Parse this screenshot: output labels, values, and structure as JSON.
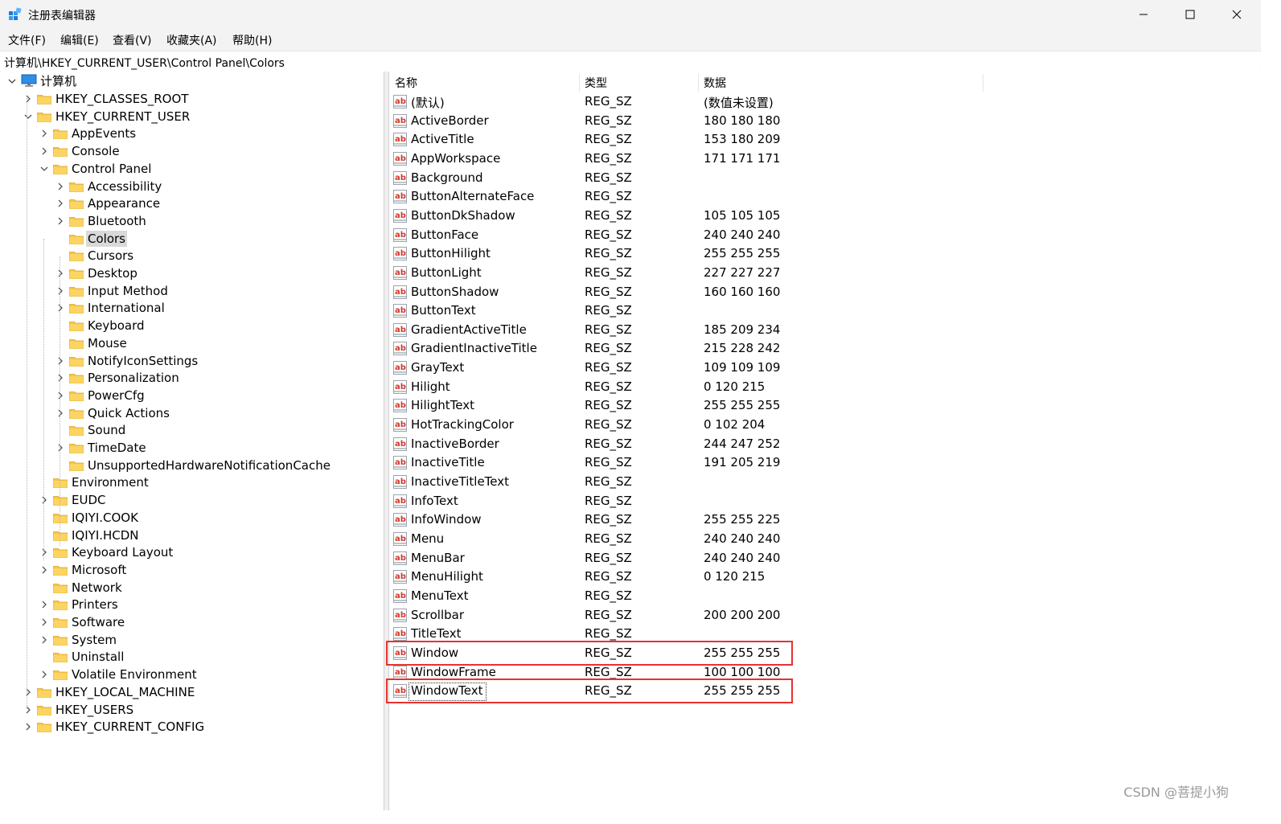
{
  "window": {
    "title": "注册表编辑器",
    "minimize_symbol": "—",
    "maximize_symbol": "☐",
    "close_symbol": "✕"
  },
  "menu": [
    "文件(F)",
    "编辑(E)",
    "查看(V)",
    "收藏夹(A)",
    "帮助(H)"
  ],
  "address": "计算机\\HKEY_CURRENT_USER\\Control Panel\\Colors",
  "tree": {
    "root": "计算机",
    "items": [
      {
        "label": "HKEY_CLASSES_ROOT",
        "level": 1,
        "expander": "collapsed"
      },
      {
        "label": "HKEY_CURRENT_USER",
        "level": 1,
        "expander": "expanded"
      },
      {
        "label": "AppEvents",
        "level": 2,
        "expander": "collapsed"
      },
      {
        "label": "Console",
        "level": 2,
        "expander": "collapsed"
      },
      {
        "label": "Control Panel",
        "level": 2,
        "expander": "expanded"
      },
      {
        "label": "Accessibility",
        "level": 3,
        "expander": "collapsed"
      },
      {
        "label": "Appearance",
        "level": 3,
        "expander": "collapsed"
      },
      {
        "label": "Bluetooth",
        "level": 3,
        "expander": "collapsed"
      },
      {
        "label": "Colors",
        "level": 3,
        "expander": "none",
        "selected": true
      },
      {
        "label": "Cursors",
        "level": 3,
        "expander": "none"
      },
      {
        "label": "Desktop",
        "level": 3,
        "expander": "collapsed"
      },
      {
        "label": "Input Method",
        "level": 3,
        "expander": "collapsed"
      },
      {
        "label": "International",
        "level": 3,
        "expander": "collapsed"
      },
      {
        "label": "Keyboard",
        "level": 3,
        "expander": "none"
      },
      {
        "label": "Mouse",
        "level": 3,
        "expander": "none"
      },
      {
        "label": "NotifyIconSettings",
        "level": 3,
        "expander": "collapsed"
      },
      {
        "label": "Personalization",
        "level": 3,
        "expander": "collapsed"
      },
      {
        "label": "PowerCfg",
        "level": 3,
        "expander": "collapsed"
      },
      {
        "label": "Quick Actions",
        "level": 3,
        "expander": "collapsed"
      },
      {
        "label": "Sound",
        "level": 3,
        "expander": "none"
      },
      {
        "label": "TimeDate",
        "level": 3,
        "expander": "collapsed"
      },
      {
        "label": "UnsupportedHardwareNotificationCache",
        "level": 3,
        "expander": "none"
      },
      {
        "label": "Environment",
        "level": 2,
        "expander": "none"
      },
      {
        "label": "EUDC",
        "level": 2,
        "expander": "collapsed"
      },
      {
        "label": "IQIYI.COOK",
        "level": 2,
        "expander": "none"
      },
      {
        "label": "IQIYI.HCDN",
        "level": 2,
        "expander": "none"
      },
      {
        "label": "Keyboard Layout",
        "level": 2,
        "expander": "collapsed"
      },
      {
        "label": "Microsoft",
        "level": 2,
        "expander": "collapsed"
      },
      {
        "label": "Network",
        "level": 2,
        "expander": "none"
      },
      {
        "label": "Printers",
        "level": 2,
        "expander": "collapsed"
      },
      {
        "label": "Software",
        "level": 2,
        "expander": "collapsed"
      },
      {
        "label": "System",
        "level": 2,
        "expander": "collapsed"
      },
      {
        "label": "Uninstall",
        "level": 2,
        "expander": "none"
      },
      {
        "label": "Volatile Environment",
        "level": 2,
        "expander": "collapsed"
      },
      {
        "label": "HKEY_LOCAL_MACHINE",
        "level": 1,
        "expander": "collapsed"
      },
      {
        "label": "HKEY_USERS",
        "level": 1,
        "expander": "collapsed"
      },
      {
        "label": "HKEY_CURRENT_CONFIG",
        "level": 1,
        "expander": "collapsed"
      }
    ]
  },
  "list": {
    "columns": [
      "名称",
      "类型",
      "数据"
    ],
    "rows": [
      {
        "name": "(默认)",
        "type": "REG_SZ",
        "data": "(数值未设置)"
      },
      {
        "name": "ActiveBorder",
        "type": "REG_SZ",
        "data": "180 180 180"
      },
      {
        "name": "ActiveTitle",
        "type": "REG_SZ",
        "data": "153 180 209"
      },
      {
        "name": "AppWorkspace",
        "type": "REG_SZ",
        "data": "171 171 171"
      },
      {
        "name": "Background",
        "type": "REG_SZ",
        "data": ""
      },
      {
        "name": "ButtonAlternateFace",
        "type": "REG_SZ",
        "data": ""
      },
      {
        "name": "ButtonDkShadow",
        "type": "REG_SZ",
        "data": "105 105 105"
      },
      {
        "name": "ButtonFace",
        "type": "REG_SZ",
        "data": "240 240 240"
      },
      {
        "name": "ButtonHilight",
        "type": "REG_SZ",
        "data": "255 255 255"
      },
      {
        "name": "ButtonLight",
        "type": "REG_SZ",
        "data": "227 227 227"
      },
      {
        "name": "ButtonShadow",
        "type": "REG_SZ",
        "data": "160 160 160"
      },
      {
        "name": "ButtonText",
        "type": "REG_SZ",
        "data": ""
      },
      {
        "name": "GradientActiveTitle",
        "type": "REG_SZ",
        "data": "185 209 234"
      },
      {
        "name": "GradientInactiveTitle",
        "type": "REG_SZ",
        "data": "215 228 242"
      },
      {
        "name": "GrayText",
        "type": "REG_SZ",
        "data": "109 109 109"
      },
      {
        "name": "Hilight",
        "type": "REG_SZ",
        "data": "0 120 215"
      },
      {
        "name": "HilightText",
        "type": "REG_SZ",
        "data": "255 255 255"
      },
      {
        "name": "HotTrackingColor",
        "type": "REG_SZ",
        "data": "0 102 204"
      },
      {
        "name": "InactiveBorder",
        "type": "REG_SZ",
        "data": "244 247 252"
      },
      {
        "name": "InactiveTitle",
        "type": "REG_SZ",
        "data": "191 205 219"
      },
      {
        "name": "InactiveTitleText",
        "type": "REG_SZ",
        "data": ""
      },
      {
        "name": "InfoText",
        "type": "REG_SZ",
        "data": ""
      },
      {
        "name": "InfoWindow",
        "type": "REG_SZ",
        "data": "255 255 225"
      },
      {
        "name": "Menu",
        "type": "REG_SZ",
        "data": "240 240 240"
      },
      {
        "name": "MenuBar",
        "type": "REG_SZ",
        "data": "240 240 240"
      },
      {
        "name": "MenuHilight",
        "type": "REG_SZ",
        "data": "0 120 215"
      },
      {
        "name": "MenuText",
        "type": "REG_SZ",
        "data": ""
      },
      {
        "name": "Scrollbar",
        "type": "REG_SZ",
        "data": "200 200 200"
      },
      {
        "name": "TitleText",
        "type": "REG_SZ",
        "data": ""
      },
      {
        "name": "Window",
        "type": "REG_SZ",
        "data": "255 255 255",
        "highlighted": true
      },
      {
        "name": "WindowFrame",
        "type": "REG_SZ",
        "data": "100 100 100"
      },
      {
        "name": "WindowText",
        "type": "REG_SZ",
        "data": "255 255 255",
        "highlighted": true,
        "focused": true
      }
    ]
  },
  "icons": {
    "app": "registry-editor-icon",
    "tree_root": "computer-icon",
    "tree_node": "folder-icon",
    "value": "string-value-icon"
  },
  "colors": {
    "highlight_border": "#e8312f",
    "folder": "#f7c64c",
    "selection": "#d9d9d9"
  },
  "watermark": "CSDN @菩提小狗"
}
